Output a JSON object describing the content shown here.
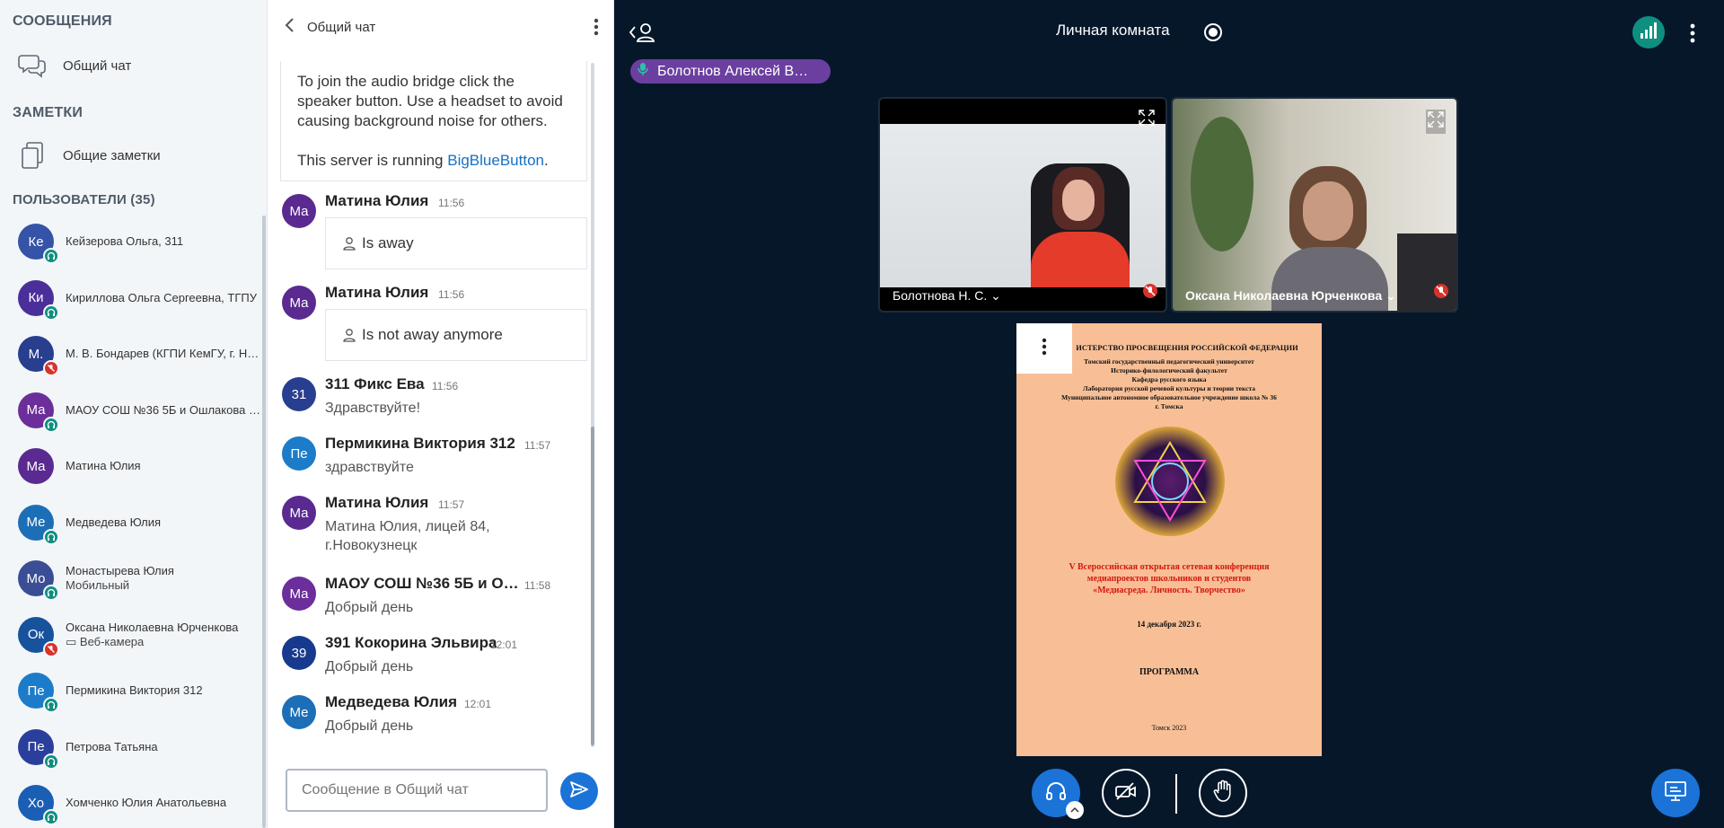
{
  "sidebar": {
    "messages_title": "СООБЩЕНИЯ",
    "public_chat": "Общий чат",
    "notes_title": "ЗАМЕТКИ",
    "shared_notes": "Общие заметки",
    "users_title": "ПОЛЬЗОВАТЕЛИ (35)",
    "users": [
      {
        "initials": "Ке",
        "name": "Кейзерова Ольга, 311",
        "sub": "",
        "color": "#3553a7",
        "status": "audio"
      },
      {
        "initials": "Ки",
        "name": "Кириллова Ольга Сергеевна, ТГПУ",
        "sub": "",
        "color": "#4a2f9a",
        "status": "audio"
      },
      {
        "initials": "М.",
        "name": "М. В. Бондарев (КГПИ КемГУ, г. Н…",
        "sub": "",
        "color": "#283e8f",
        "status": "muted"
      },
      {
        "initials": "Ма",
        "name": "МАОУ СОШ №36 5Б и Ошлакова Е…",
        "sub": "",
        "color": "#6b2e9a",
        "status": "audio"
      },
      {
        "initials": "Ма",
        "name": "Матина Юлия",
        "sub": "",
        "color": "#5a2a91",
        "status": ""
      },
      {
        "initials": "Ме",
        "name": "Медведева Юлия",
        "sub": "",
        "color": "#1c6fb6",
        "status": "audio"
      },
      {
        "initials": "Мо",
        "name": "Монастырева Юлия",
        "sub": "Мобильный",
        "color": "#3b4d94",
        "status": "audio"
      },
      {
        "initials": "Ок",
        "name": "Оксана Николаевна Юрченкова",
        "sub": "▭ Веб-камера",
        "color": "#17529d",
        "status": "muted"
      },
      {
        "initials": "Пе",
        "name": "Пермикина Виктория 312",
        "sub": "",
        "color": "#1d7cc9",
        "status": "audio"
      },
      {
        "initials": "Пе",
        "name": "Петрова Татьяна",
        "sub": "",
        "color": "#2a3f9c",
        "status": "audio"
      },
      {
        "initials": "Хо",
        "name": "Хомченко Юлия Анатольевна",
        "sub": "",
        "color": "#1a5fb3",
        "status": "audio"
      }
    ]
  },
  "chat": {
    "title": "Общий чат",
    "welcome_line1": "To join the audio bridge click the speaker button. Use a headset to avoid causing background noise for others.",
    "welcome_line2_prefix": "This server is running ",
    "welcome_link": "BigBlueButton",
    "welcome_line2_suffix": ".",
    "messages": [
      {
        "initials": "Ма",
        "name": "Матина Юлия",
        "time": "11:56",
        "text": "Is away",
        "boxed": true,
        "color": "#5a2a91"
      },
      {
        "initials": "Ма",
        "name": "Матина Юлия",
        "time": "11:56",
        "text": "Is not away anymore",
        "boxed": true,
        "color": "#5a2a91"
      },
      {
        "initials": "31",
        "name": "311 Фикс Ева",
        "time": "11:56",
        "text": "Здравствуйте!",
        "boxed": false,
        "color": "#283e8f"
      },
      {
        "initials": "Пе",
        "name": "Пермикина Виктория 312",
        "time": "11:57",
        "text": "здравствуйте",
        "boxed": false,
        "color": "#1d7cc9"
      },
      {
        "initials": "Ма",
        "name": "Матина Юлия",
        "time": "11:57",
        "text": "Матина Юлия, лицей 84, г.Новокузнецк",
        "boxed": false,
        "color": "#5a2a91"
      },
      {
        "initials": "Ма",
        "name": "МАОУ СОШ №36 5Б и О…",
        "time": "11:58",
        "text": "Добрый день",
        "boxed": false,
        "color": "#6b2e9a"
      },
      {
        "initials": "39",
        "name": "391 Кокорина Эльвира",
        "time": "12:01",
        "text": "Добрый день",
        "boxed": false,
        "color": "#183a8e"
      },
      {
        "initials": "Ме",
        "name": "Медведева Юлия",
        "time": "12:01",
        "text": "Добрый день",
        "boxed": false,
        "color": "#1c6fb6"
      }
    ],
    "input_placeholder": "Сообщение в Общий чат"
  },
  "main": {
    "room_title": "Личная комната",
    "talking_user": "Болотнов Алексей В…",
    "videos": [
      {
        "name": "Болотнова Н. С."
      },
      {
        "name": "Оксана Николаевна Юрченкова"
      }
    ],
    "slide": {
      "header": "ИСТЕРСТВО ПРОСВЕЩЕНИЯ РОССИЙСКОЙ ФЕДЕРАЦИИ",
      "org_lines": [
        "Томский государственный педагогический университет",
        "Историко-филологический факультет",
        "Кафедра русского языка",
        "Лаборатория русской речевой культуры и теории текста",
        "Муниципальное автономное образовательное учреждение школа № 36",
        "г. Томска"
      ],
      "conf_lines": [
        "V Всероссийская открытая сетевая конференция",
        "медиапроектов  школьников и студентов",
        "«Медиасреда. Личность. Творчество»"
      ],
      "date": "14 декабря 2023 г.",
      "program": "ПРОГРАММА",
      "city": "Томск 2023"
    }
  },
  "colors": {
    "accent": "#1b73d8",
    "bg_dark": "#06172a",
    "talk": "#6b3fa0",
    "status_audio": "#0f8f7f",
    "status_muted": "#d9322b",
    "network": "#0f8f7f"
  }
}
